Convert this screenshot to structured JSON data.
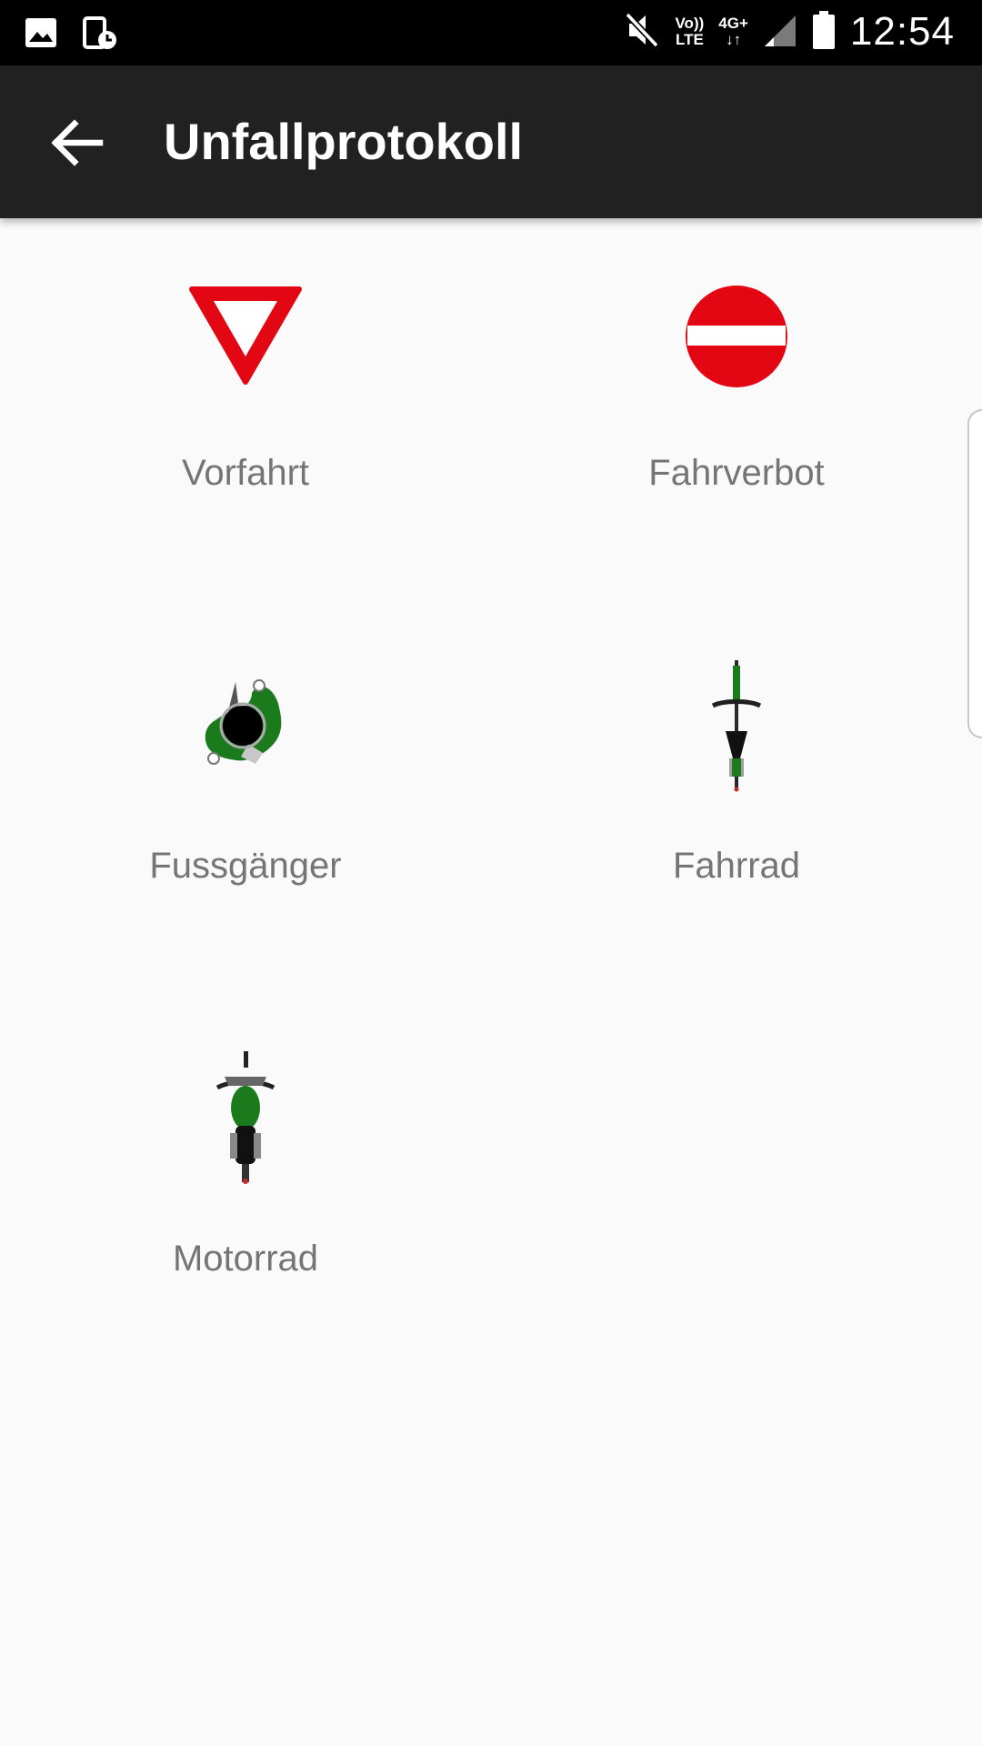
{
  "status_bar": {
    "left_icons": [
      "gallery-icon",
      "screen-timer-icon"
    ],
    "right_icons": [
      "mute-icon",
      "volte-icon",
      "network-4g-icon",
      "signal-icon",
      "battery-icon"
    ],
    "volte_top": "Vo))",
    "volte_bottom": "LTE",
    "network_label": "4G+",
    "network_arrows": "↓↑",
    "time": "12:54"
  },
  "app_bar": {
    "back_icon": "arrow-back-icon",
    "title": "Unfallprotokoll"
  },
  "items": [
    {
      "label": "Vorfahrt",
      "icon": "yield-sign-icon",
      "color": "#e30613"
    },
    {
      "label": "Fahrverbot",
      "icon": "no-entry-sign-icon",
      "color": "#e30613"
    },
    {
      "label": "Fussgänger",
      "icon": "pedestrian-icon",
      "color": "#1b7a1b"
    },
    {
      "label": "Fahrrad",
      "icon": "bicycle-icon",
      "color": "#1b7a1b"
    },
    {
      "label": "Motorrad",
      "icon": "motorcycle-icon",
      "color": "#1b7a1b"
    }
  ],
  "colors": {
    "app_bar": "#212121",
    "background": "#fafafa",
    "label_text": "#757575",
    "sign_red": "#e30613",
    "figure_green": "#1b7a1b"
  }
}
